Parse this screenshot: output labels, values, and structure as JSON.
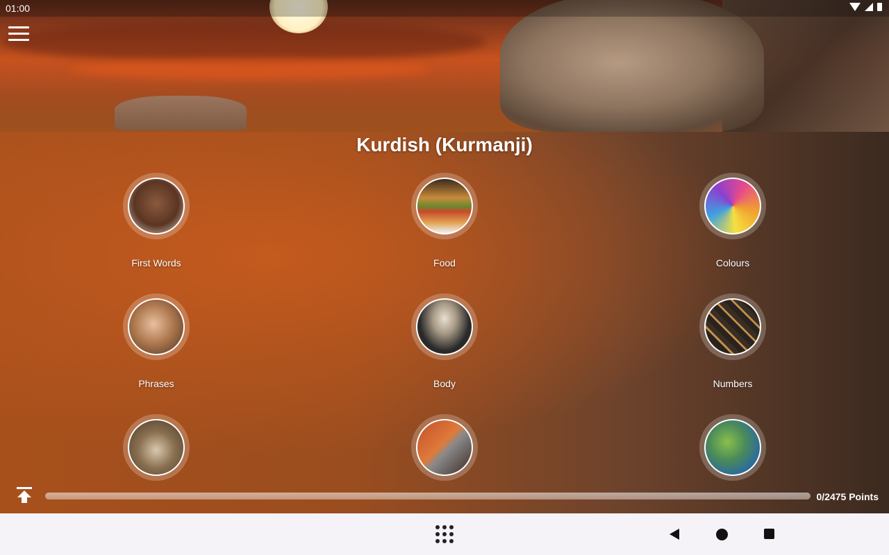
{
  "status_bar": {
    "time": "01:00",
    "icons": [
      "wifi-icon",
      "signal-icon",
      "battery-icon"
    ]
  },
  "header": {
    "title": "Kurdish (Kurmanji)",
    "menu_icon": "hamburger-menu-icon"
  },
  "categories": [
    {
      "label": "First Words",
      "icon": "child-face-photo"
    },
    {
      "label": "Food",
      "icon": "burger-photo"
    },
    {
      "label": "Colours",
      "icon": "color-powder-photo"
    },
    {
      "label": "Phrases",
      "icon": "smiling-woman-photo"
    },
    {
      "label": "Body",
      "icon": "skeleton-photo"
    },
    {
      "label": "Numbers",
      "icon": "number-blocks-photo"
    },
    {
      "label": "",
      "icon": "alarm-clock-photo"
    },
    {
      "label": "",
      "icon": "shopping-cart-photo"
    },
    {
      "label": "",
      "icon": "world-map-photo"
    }
  ],
  "progress": {
    "points_label": "0/2475 Points",
    "points": 0,
    "max_points": 2475,
    "fraction": 0.0
  },
  "navbar": {
    "apps_icon": "apps-grid-icon",
    "back_icon": "back-triangle-icon",
    "home_icon": "home-circle-icon",
    "recents_icon": "recents-square-icon"
  },
  "colors": {
    "accent": "#c45a1e",
    "navbar_bg": "#f5f3f8"
  }
}
